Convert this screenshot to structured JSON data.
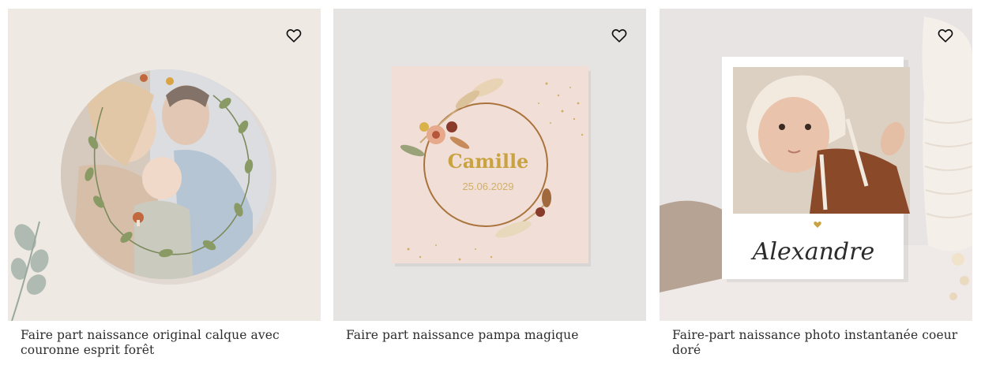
{
  "products": [
    {
      "title": "Faire part naissance original calque avec couronne esprit forêt",
      "favorite_icon": "heart-outline-icon",
      "background_color": "#ece6e1"
    },
    {
      "title": "Faire part naissance pampa magique",
      "favorite_icon": "heart-outline-icon",
      "background_color": "#e6e3e3",
      "card_name": "Camille",
      "card_date": "25.06.2029"
    },
    {
      "title": "Faire-part naissance photo instantanée coeur doré",
      "favorite_icon": "heart-outline-icon",
      "background_color": "#e8e4e4",
      "card_name": "Alexandre"
    }
  ]
}
